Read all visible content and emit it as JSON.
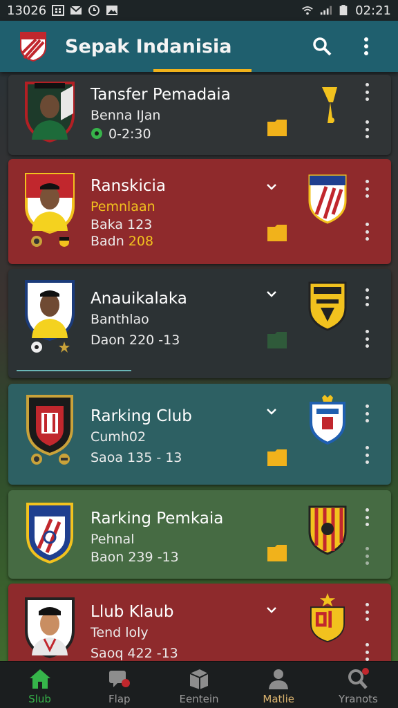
{
  "status_bar": {
    "time": "13026",
    "clock": "02:21"
  },
  "app_bar": {
    "title": "Sepak Indanisia"
  },
  "cards": [
    {
      "title": "Tansfer Pemadaia",
      "line1": "Benna IJan",
      "line2": "0-2:30",
      "bg": "#303436"
    },
    {
      "title": "Ranskicia",
      "line1": "Pemnlaan",
      "line2": "Baka 123",
      "line3_prefix": "Badn",
      "line3_value": "208",
      "bg": "#8f2a2c"
    },
    {
      "title": "Anauikalaka",
      "line1": "Banthlao",
      "line2": "Daon 220 -13",
      "bg": "#2c3234"
    },
    {
      "title": "Rarking Club",
      "line1": "Cumh02",
      "line2": "Saoa 135 - 13",
      "bg": "#2d6063"
    },
    {
      "title": "Rarking Pemkaia",
      "line1": "Pehnal",
      "line2": "Baon 239 -13",
      "bg": "#466b43"
    },
    {
      "title": "Llub Klaub",
      "line1": "Tend loly",
      "line2": "Saoq 422 -13",
      "bg": "#8e2a2c"
    }
  ],
  "nav": [
    {
      "label": "Slub",
      "icon": "home-icon"
    },
    {
      "label": "Flap",
      "icon": "chat-icon"
    },
    {
      "label": "Eentein",
      "icon": "box-icon"
    },
    {
      "label": "Matlie",
      "icon": "person-icon"
    },
    {
      "label": "Yranots",
      "icon": "search-alert-icon"
    }
  ]
}
